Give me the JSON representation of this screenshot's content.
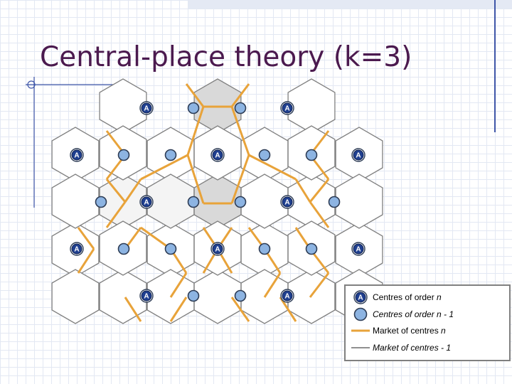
{
  "title": "Central-place theory (k=3)",
  "node_a_label": "A",
  "colors": {
    "title": "#4b1a4f",
    "market_n": "#e8a33a",
    "market_n1": "#808080",
    "centre_n": "#1f3f8f",
    "centre_n1": "#8db4e2",
    "shaded_region": "#d9d9d9"
  },
  "legend": {
    "items": [
      {
        "symbol": "A",
        "text": "Centres of order ",
        "var": "n"
      },
      {
        "text": "Centres of order n - 1"
      },
      {
        "text": "Market of centres ",
        "var": "n"
      },
      {
        "text": "Market of centres  - 1"
      }
    ]
  }
}
